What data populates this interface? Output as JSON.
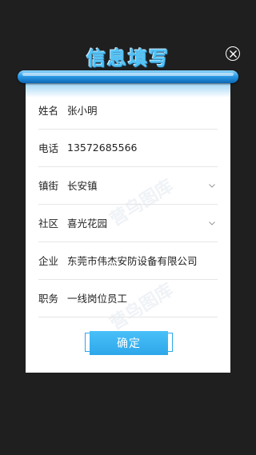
{
  "dialog": {
    "title": "信息填写",
    "fields": [
      {
        "label": "姓名",
        "value": "张小明"
      },
      {
        "label": "电话",
        "value": "13572685566"
      },
      {
        "label": "镇街",
        "value": "长安镇",
        "dropdown": true
      },
      {
        "label": "社区",
        "value": "喜光花园",
        "dropdown": true
      },
      {
        "label": "企业",
        "value": "东莞市伟杰安防设备有限公司"
      },
      {
        "label": "职务",
        "value": "一线岗位员工"
      }
    ],
    "confirm_label": "确定"
  },
  "watermark": "营鸟图库",
  "colors": {
    "background": "#1f1f20",
    "accent": "#2ea7ea",
    "title": "#4fc3f7",
    "card": "#ffffff"
  },
  "icons": {
    "close": "close-icon",
    "dropdown": "chevron-down-icon"
  }
}
